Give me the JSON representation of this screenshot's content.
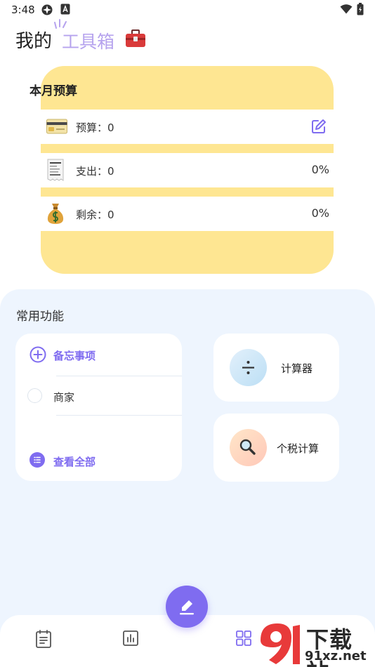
{
  "status_bar": {
    "time": "3:48"
  },
  "header": {
    "title_prefix": "我的",
    "title_accent": "工具箱"
  },
  "budget": {
    "title": "本月预算",
    "rows": [
      {
        "label": "预算：0",
        "percent": ""
      },
      {
        "label": "支出：0",
        "percent": "0%"
      },
      {
        "label": "剩余：0",
        "percent": "0%"
      }
    ]
  },
  "features": {
    "title": "常用功能",
    "memo": {
      "add_label": "备忘事项",
      "items": [
        {
          "label": "商家"
        }
      ],
      "view_all_label": "查看全部"
    },
    "tools": [
      {
        "label": "计算器"
      },
      {
        "label": "个税计算"
      }
    ]
  },
  "watermark": {
    "brand": "下载站",
    "url": "91xz.net"
  },
  "colors": {
    "accent": "#7f6cf0",
    "budget_card": "#fee692",
    "panel_bg": "#eef5fe",
    "title_accent": "#b6a3ee"
  },
  "icons": {
    "budget_rows": [
      "credit-card-icon",
      "receipt-icon",
      "money-bag-icon"
    ],
    "tools": [
      "divide-icon",
      "magnifier-icon"
    ],
    "nav": [
      "notes-nav-icon",
      "chart-nav-icon",
      "grid-nav-icon"
    ]
  }
}
